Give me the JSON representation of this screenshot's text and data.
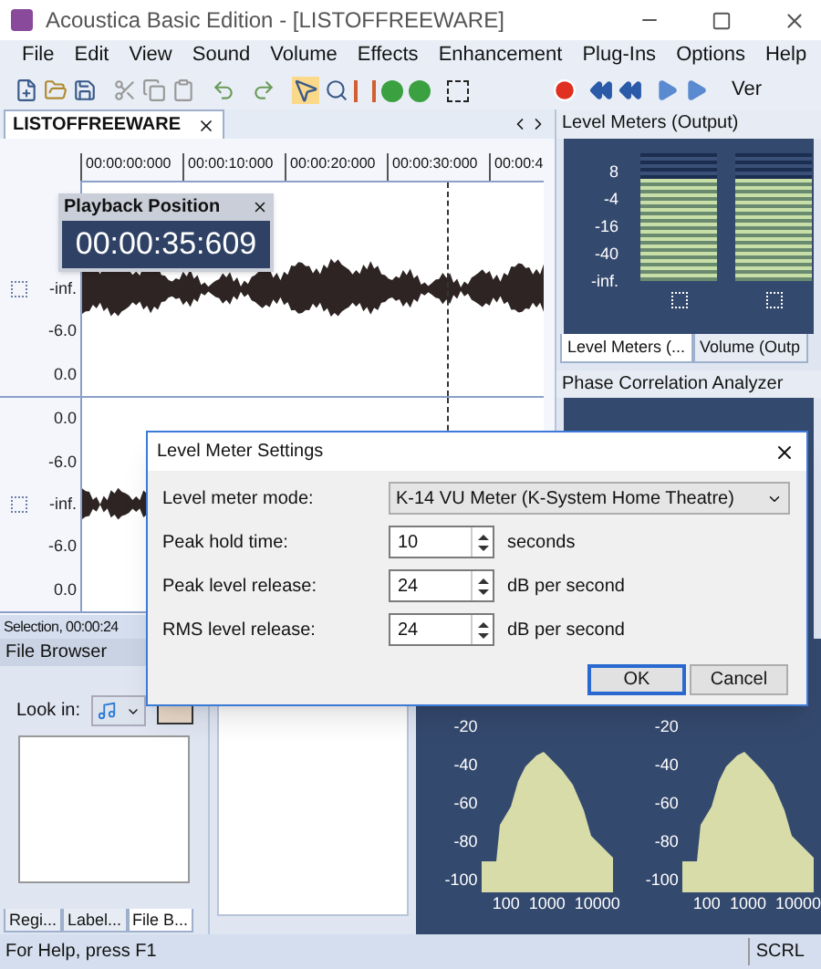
{
  "window": {
    "title": "Acoustica Basic Edition - [LISTOFFREEWARE]"
  },
  "menu": [
    "File",
    "Edit",
    "View",
    "Sound",
    "Volume",
    "Effects",
    "Enhancement",
    "Plug-Ins",
    "Options",
    "Help"
  ],
  "toolbar": {
    "overflow_text": "Ver"
  },
  "document_tab": {
    "label": "LISTOFFREEWARE"
  },
  "ruler": [
    "00:00:00:000",
    "00:00:10:000",
    "00:00:20:000",
    "00:00:30:000",
    "00:00:4"
  ],
  "channels": [
    {
      "db_labels": [
        "-inf.",
        "-6.0",
        "0.0"
      ]
    },
    {
      "db_labels": [
        "0.0",
        "-6.0",
        "-inf.",
        "-6.0",
        "0.0"
      ]
    }
  ],
  "playback_position": {
    "title": "Playback Position",
    "time": "00:00:35:609"
  },
  "selection_status": "Selection, 00:00:24",
  "level_meters": {
    "title": "Level Meters (Output)",
    "scale": [
      "8",
      "-4",
      "-16",
      "-40",
      "-inf."
    ],
    "meters": [
      {
        "level": 0.8
      },
      {
        "level": 0.8
      }
    ],
    "tabs": [
      {
        "label": "Level Meters (...",
        "selected": true
      },
      {
        "label": "Volume (Outp",
        "selected": false
      }
    ]
  },
  "phase_panel": {
    "title": "Phase Correlation Analyzer"
  },
  "file_browser": {
    "title": "File Browser",
    "look_in_label": "Look in:",
    "tabs": [
      {
        "label": "Regi...",
        "selected": false
      },
      {
        "label": "Label...",
        "selected": false
      },
      {
        "label": "File B...",
        "selected": true
      }
    ]
  },
  "spectrum": {
    "panes": [
      {
        "y_labels": [
          "-20",
          "-40",
          "-60",
          "-80",
          "-100"
        ],
        "x_labels": [
          "100",
          "1000",
          "10000"
        ]
      },
      {
        "y_labels": [
          "-20",
          "-40",
          "-60",
          "-80",
          "-100"
        ],
        "x_labels": [
          "100",
          "1000",
          "10000"
        ]
      }
    ]
  },
  "dialog": {
    "title": "Level Meter Settings",
    "mode": {
      "label": "Level meter mode:",
      "value": "K-14 VU Meter (K-System Home Theatre)"
    },
    "fields": [
      {
        "label": "Peak hold time:",
        "value": "10",
        "unit": "seconds"
      },
      {
        "label": "Peak level release:",
        "value": "24",
        "unit": "dB per second"
      },
      {
        "label": "RMS level release:",
        "value": "24",
        "unit": "dB per second"
      }
    ],
    "buttons": [
      {
        "label": "OK",
        "default": true
      },
      {
        "label": "Cancel",
        "default": false
      }
    ]
  },
  "status_bar": {
    "help": "For Help, press F1",
    "indicator": "SCRL"
  }
}
